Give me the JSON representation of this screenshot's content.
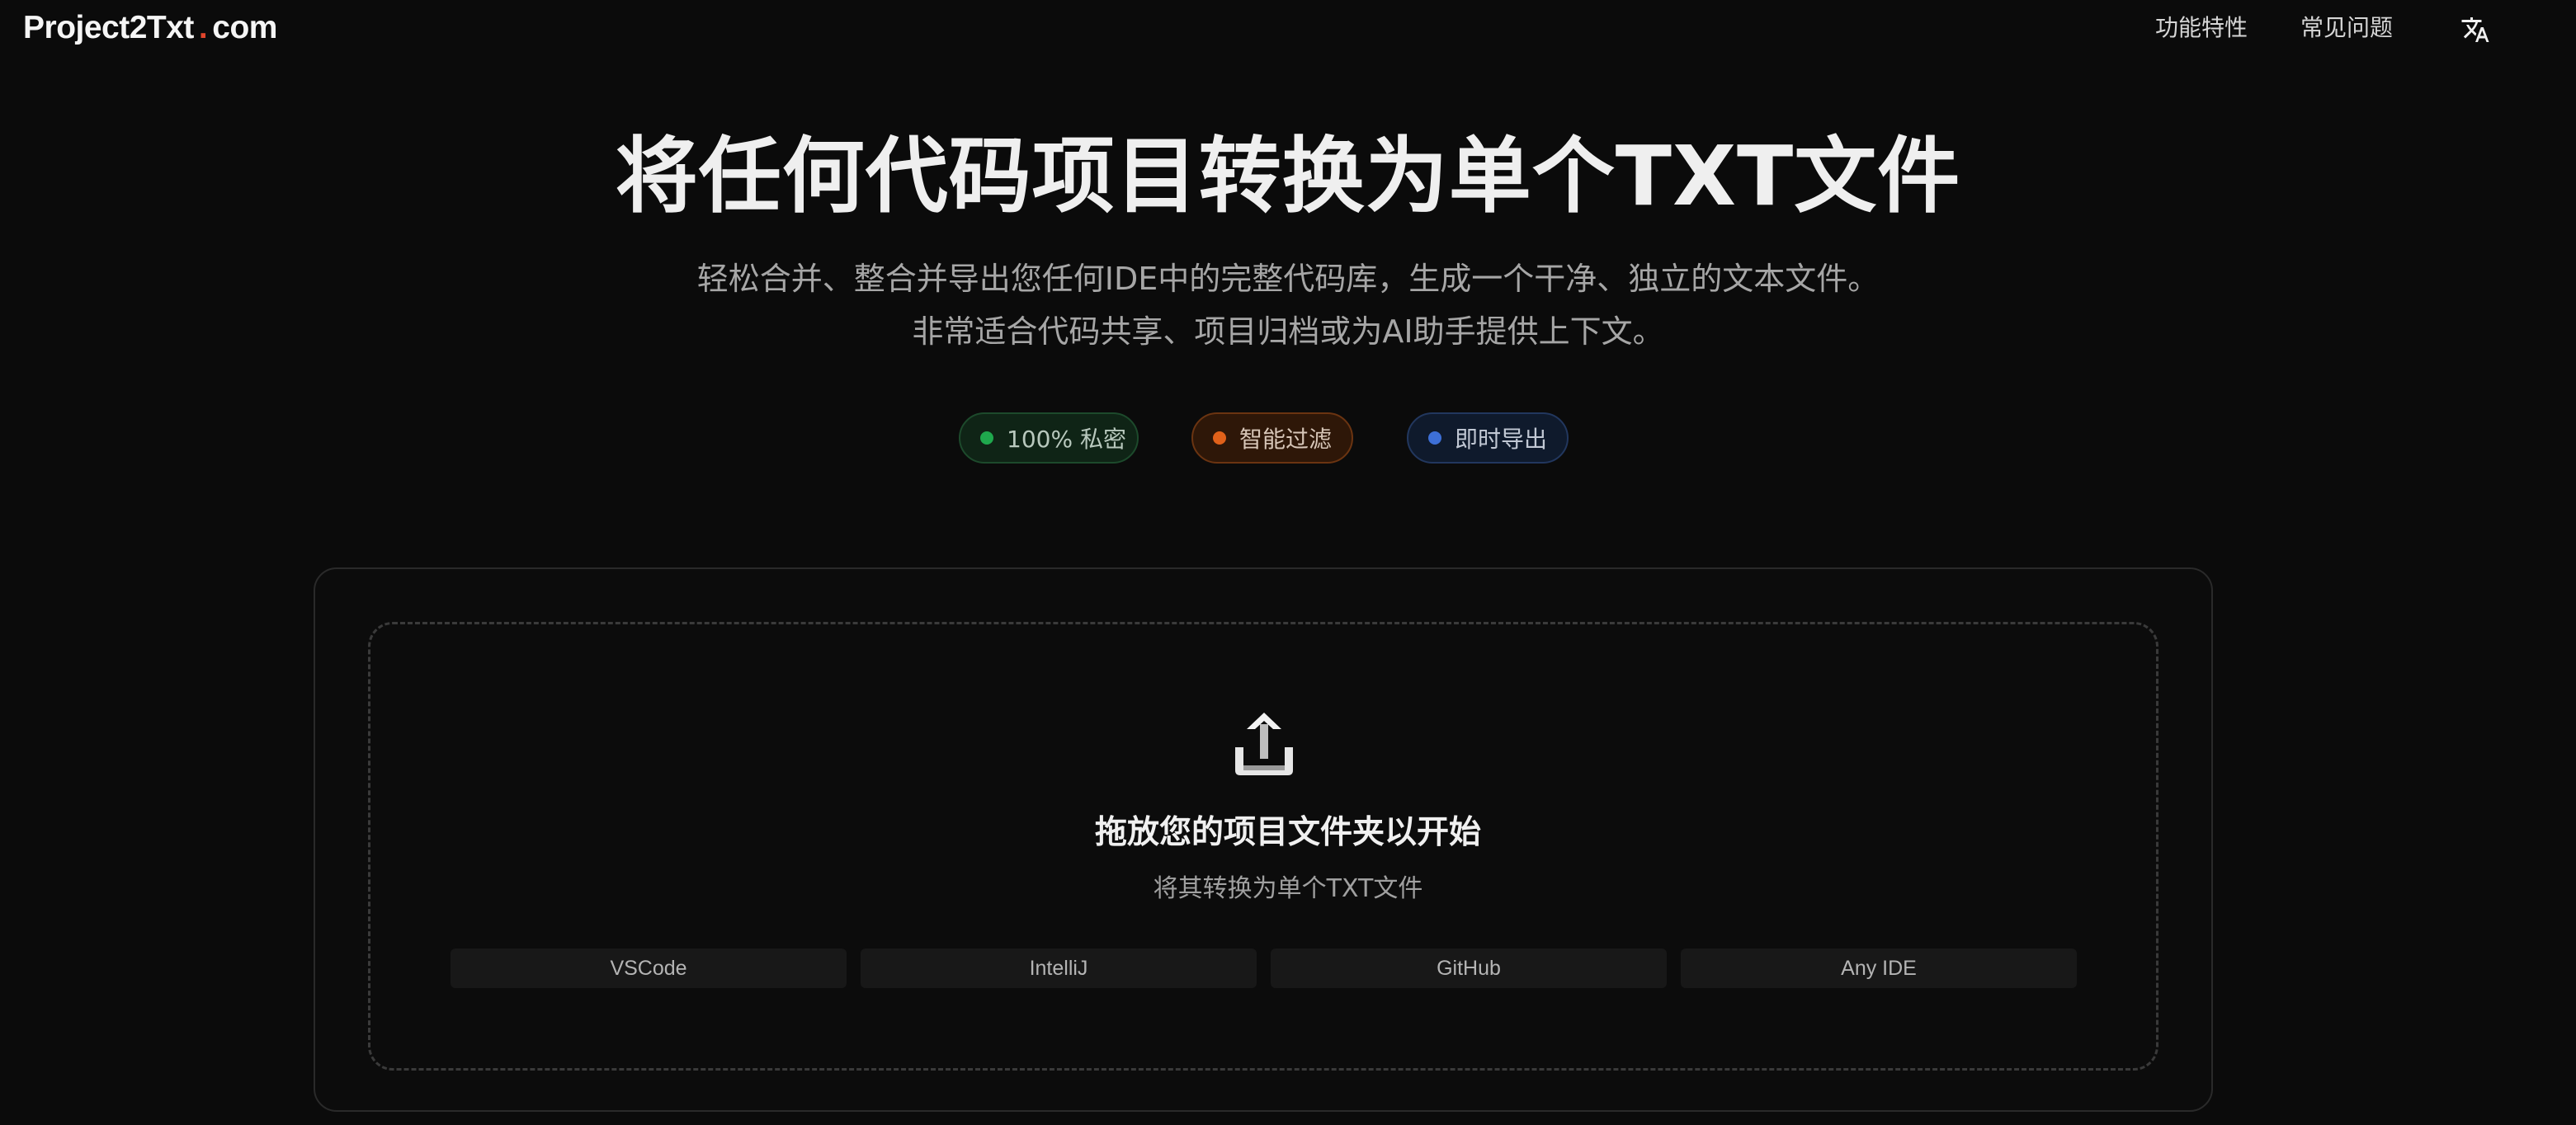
{
  "header": {
    "logo": {
      "name": "Project2Txt",
      "dot": ".",
      "tld": "com",
      "dot_color": "#e0452b"
    },
    "nav": [
      {
        "label": "功能特性"
      },
      {
        "label": "常见问题"
      }
    ],
    "language_icon": "translate-icon"
  },
  "hero": {
    "title": "将任何代码项目转换为单个TXT文件",
    "subtitle_line1": "轻松合并、整合并导出您任何IDE中的完整代码库，生成一个干净、独立的文本文件。",
    "subtitle_line2": "非常适合代码共享、项目归档或为AI助手提供上下文。",
    "badges": [
      {
        "label": "100% 私密",
        "dot_color": "#1fa84d"
      },
      {
        "label": "智能过滤",
        "dot_color": "#e0611a"
      },
      {
        "label": "即时导出",
        "dot_color": "#3d6fd6"
      }
    ]
  },
  "upload": {
    "icon": "upload-icon",
    "title": "拖放您的项目文件夹以开始",
    "subtitle": "将其转换为单个TXT文件",
    "ide_list": [
      "VSCode",
      "IntelliJ",
      "GitHub",
      "Any IDE"
    ]
  }
}
